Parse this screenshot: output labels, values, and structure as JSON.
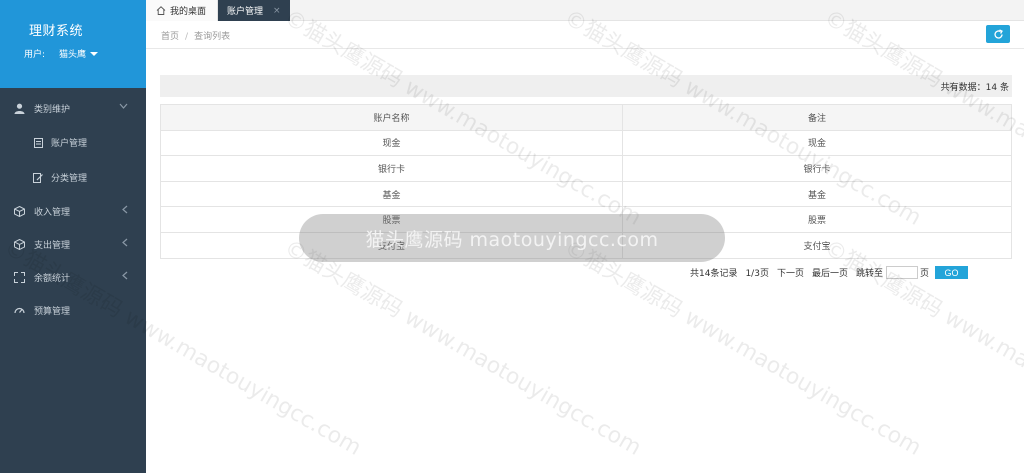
{
  "sidebar": {
    "app_title": "理财系统",
    "user_label": "用户:",
    "user_name": "猫头鹰",
    "items": [
      {
        "label": "类别维护",
        "icon": "user-icon",
        "expanded": true
      },
      {
        "label": "账户管理",
        "icon": "document-icon",
        "sub": true
      },
      {
        "label": "分类管理",
        "icon": "edit-doc-icon",
        "sub": true
      },
      {
        "label": "收入管理",
        "icon": "cube-icon"
      },
      {
        "label": "支出管理",
        "icon": "cube-icon"
      },
      {
        "label": "余额统计",
        "icon": "expand-icon"
      },
      {
        "label": "预算管理",
        "icon": "gauge-icon"
      }
    ]
  },
  "tabs": {
    "home": "我的桌面",
    "active": "账户管理",
    "close": "×"
  },
  "breadcrumb": {
    "home": "首页",
    "sep": "/",
    "current": "查询列表"
  },
  "summary": {
    "count_text": "共有数据：14 条"
  },
  "table": {
    "headers": [
      "账户名称",
      "备注"
    ],
    "rows": [
      [
        "现金",
        "现金"
      ],
      [
        "银行卡",
        "银行卡"
      ],
      [
        "基金",
        "基金"
      ],
      [
        "股票",
        "股票"
      ],
      [
        "支付宝",
        "支付宝"
      ]
    ]
  },
  "pager": {
    "total": "共14条记录",
    "page": "1/3页",
    "next": "下一页",
    "last": "最后一页",
    "jump_label": "跳转至",
    "page_unit": "页",
    "go": "GO"
  },
  "watermark": {
    "pill_text": "猫头鹰源码 maotouyingcc.com",
    "diag_text": "©猫头鹰源码 www.maotouyingcc.com"
  },
  "colors": {
    "sidebar_bg": "#2f4050",
    "header_blue": "#2196d9",
    "accent": "#23a4d9"
  }
}
